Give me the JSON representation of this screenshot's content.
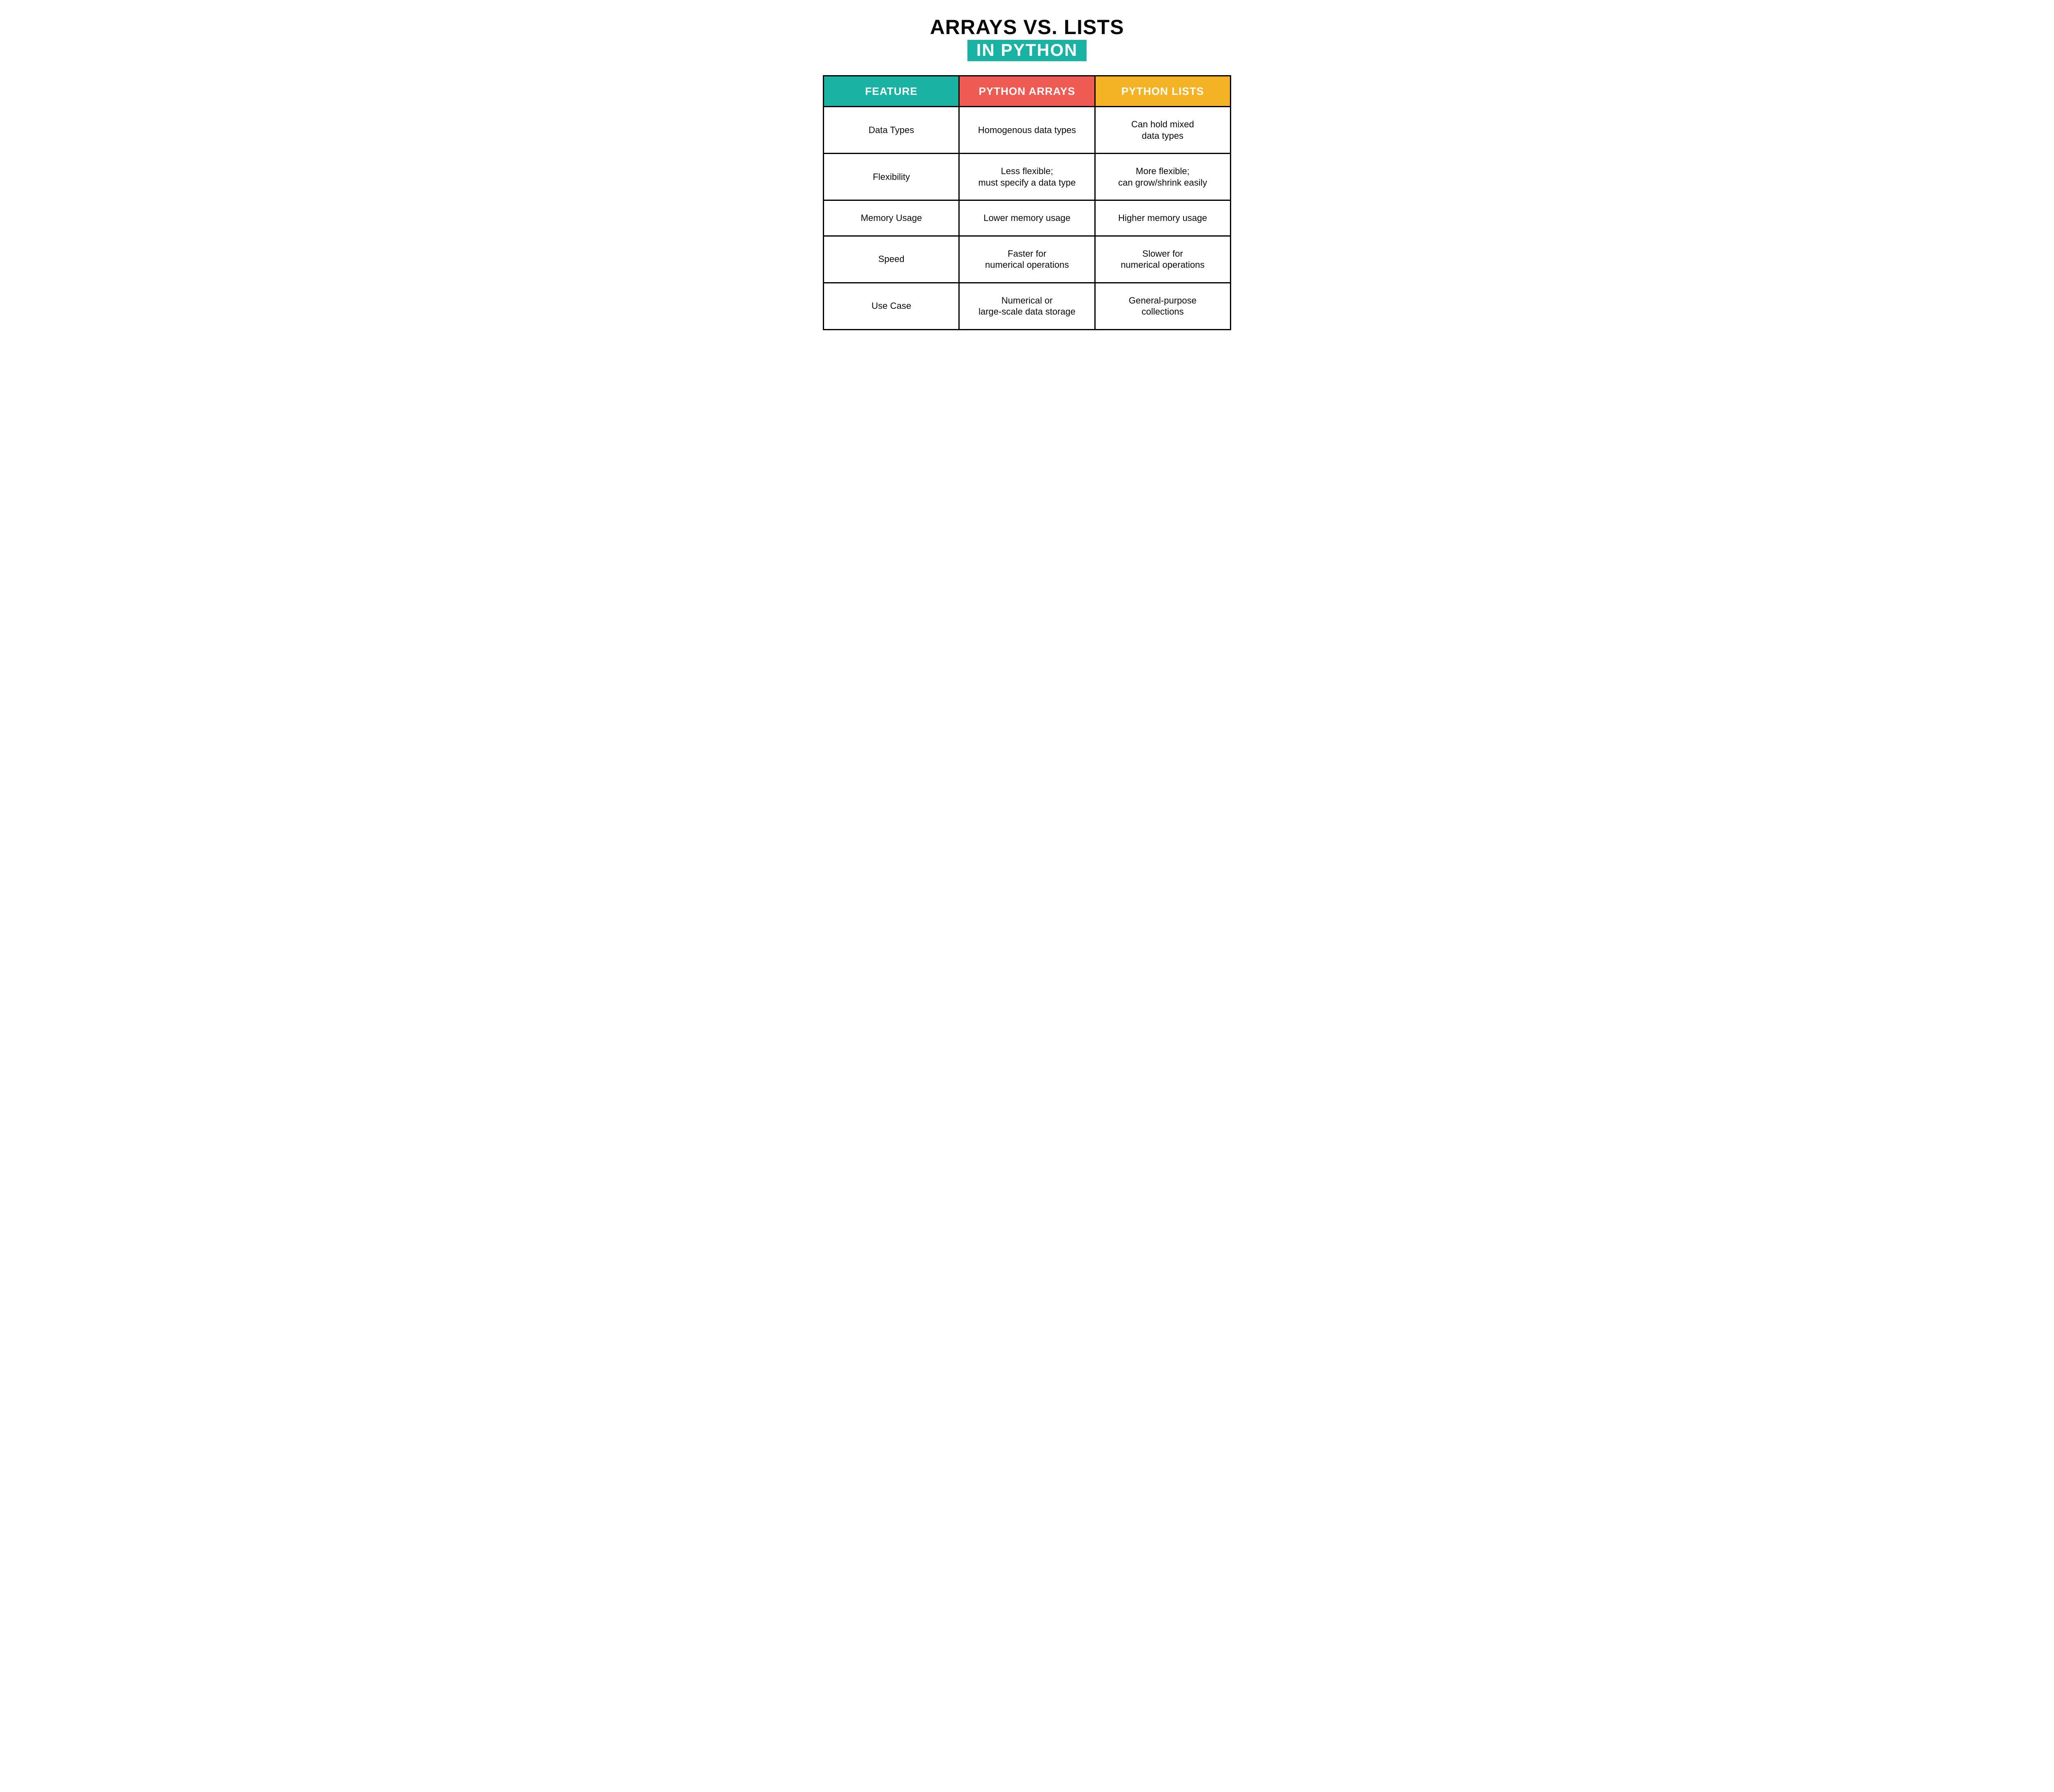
{
  "title": {
    "line1": "ARRAYS VS. LISTS",
    "line2": "IN PYTHON"
  },
  "headers": {
    "feature": "FEATURE",
    "arrays": "PYTHON ARRAYS",
    "lists": "PYTHON LISTS"
  },
  "rows": [
    {
      "feature": "Data Types",
      "arrays": "Homogenous data types",
      "lists": "Can hold mixed\ndata types"
    },
    {
      "feature": "Flexibility",
      "arrays": "Less flexible;\nmust specify a data type",
      "lists": "More flexible;\ncan grow/shrink easily"
    },
    {
      "feature": "Memory Usage",
      "arrays": "Lower memory usage",
      "lists": "Higher memory usage"
    },
    {
      "feature": "Speed",
      "arrays": "Faster for\nnumerical operations",
      "lists": "Slower for\nnumerical operations"
    },
    {
      "feature": "Use Case",
      "arrays": "Numerical or\nlarge-scale data storage",
      "lists": "General-purpose\ncollections"
    }
  ],
  "colors": {
    "teal": "#1ab3a3",
    "red": "#ef5b52",
    "amber": "#f3b324",
    "black": "#0a0a0a",
    "white": "#ffffff"
  },
  "chart_data": {
    "type": "table",
    "title": "Arrays vs. Lists in Python",
    "columns": [
      "Feature",
      "Python Arrays",
      "Python Lists"
    ],
    "data": [
      [
        "Data Types",
        "Homogenous data types",
        "Can hold mixed data types"
      ],
      [
        "Flexibility",
        "Less flexible; must specify a data type",
        "More flexible; can grow/shrink easily"
      ],
      [
        "Memory Usage",
        "Lower memory usage",
        "Higher memory usage"
      ],
      [
        "Speed",
        "Faster for numerical operations",
        "Slower for numerical operations"
      ],
      [
        "Use Case",
        "Numerical or large-scale data storage",
        "General-purpose collections"
      ]
    ]
  }
}
